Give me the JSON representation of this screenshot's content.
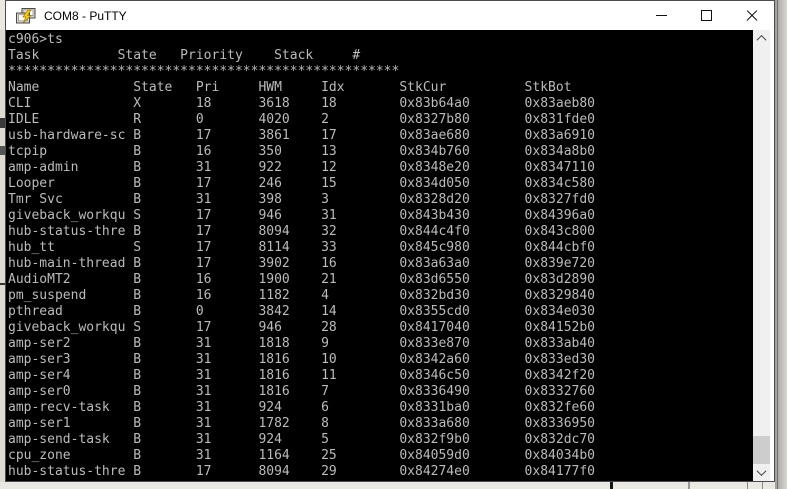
{
  "window": {
    "title": "COM8 - PuTTY",
    "controls": [
      {
        "name": "minimize"
      },
      {
        "name": "maximize"
      },
      {
        "name": "close"
      }
    ]
  },
  "terminal": {
    "colors": {
      "background": "#000000",
      "foreground": "#BBBBBB"
    },
    "prompt_line": "c906>ts",
    "summary_header": {
      "cols": [
        "Task",
        "State",
        "Priority",
        "Stack",
        "#"
      ],
      "char_offsets": [
        0,
        14,
        22,
        34,
        44
      ]
    },
    "separator_char": "*",
    "separator_count": 50,
    "table": {
      "columns": [
        "Name",
        "State",
        "Pri",
        "HWM",
        "Idx",
        "StkCur",
        "StkBot"
      ],
      "char_offsets": [
        0,
        16,
        24,
        32,
        40,
        50,
        66
      ],
      "rows": [
        [
          "CLI",
          "X",
          "18",
          "3618",
          "18",
          "0x83b64a0",
          "0x83aeb80"
        ],
        [
          "IDLE",
          "R",
          "0",
          "4020",
          "2",
          "0x8327b80",
          "0x831fde0"
        ],
        [
          "usb-hardware-sc",
          "B",
          "17",
          "3861",
          "17",
          "0x83ae680",
          "0x83a6910"
        ],
        [
          "tcpip",
          "B",
          "16",
          "350",
          "13",
          "0x834b760",
          "0x834a8b0"
        ],
        [
          "amp-admin",
          "B",
          "31",
          "922",
          "12",
          "0x8348e20",
          "0x8347110"
        ],
        [
          "Looper",
          "B",
          "17",
          "246",
          "15",
          "0x834d050",
          "0x834c580"
        ],
        [
          "Tmr Svc",
          "B",
          "31",
          "398",
          "3",
          "0x8328d20",
          "0x8327fd0"
        ],
        [
          "giveback_workqu",
          "S",
          "17",
          "946",
          "31",
          "0x843b430",
          "0x84396a0"
        ],
        [
          "hub-status-thre",
          "B",
          "17",
          "8094",
          "32",
          "0x844c4f0",
          "0x843c800"
        ],
        [
          "hub_tt",
          "S",
          "17",
          "8114",
          "33",
          "0x845c980",
          "0x844cbf0"
        ],
        [
          "hub-main-thread",
          "B",
          "17",
          "3902",
          "16",
          "0x83a63a0",
          "0x839e720"
        ],
        [
          "AudioMT2",
          "B",
          "16",
          "1900",
          "21",
          "0x83d6550",
          "0x83d2890"
        ],
        [
          "pm_suspend",
          "B",
          "16",
          "1182",
          "4",
          "0x832bd30",
          "0x8329840"
        ],
        [
          "pthread",
          "B",
          "0",
          "3842",
          "14",
          "0x8355cd0",
          "0x834e030"
        ],
        [
          "giveback_workqu",
          "S",
          "17",
          "946",
          "28",
          "0x8417040",
          "0x84152b0"
        ],
        [
          "amp-ser2",
          "B",
          "31",
          "1818",
          "9",
          "0x833e870",
          "0x833ab40"
        ],
        [
          "amp-ser3",
          "B",
          "31",
          "1816",
          "10",
          "0x8342a60",
          "0x833ed30"
        ],
        [
          "amp-ser4",
          "B",
          "31",
          "1816",
          "11",
          "0x8346c50",
          "0x8342f20"
        ],
        [
          "amp-ser0",
          "B",
          "31",
          "1816",
          "7",
          "0x8336490",
          "0x8332760"
        ],
        [
          "amp-recv-task",
          "B",
          "31",
          "924",
          "6",
          "0x8331ba0",
          "0x832fe60"
        ],
        [
          "amp-ser1",
          "B",
          "31",
          "1782",
          "8",
          "0x833a680",
          "0x8336950"
        ],
        [
          "amp-send-task",
          "B",
          "31",
          "924",
          "5",
          "0x832f9b0",
          "0x832dc70"
        ],
        [
          "cpu_zone",
          "B",
          "31",
          "1164",
          "25",
          "0x84059d0",
          "0x84034b0"
        ],
        [
          "hub-status-thre",
          "B",
          "17",
          "8094",
          "29",
          "0x84274e0",
          "0x84177f0"
        ]
      ]
    }
  },
  "scrollbar": {
    "up_icon": "scroll-up-icon",
    "down_icon": "scroll-down-icon"
  }
}
